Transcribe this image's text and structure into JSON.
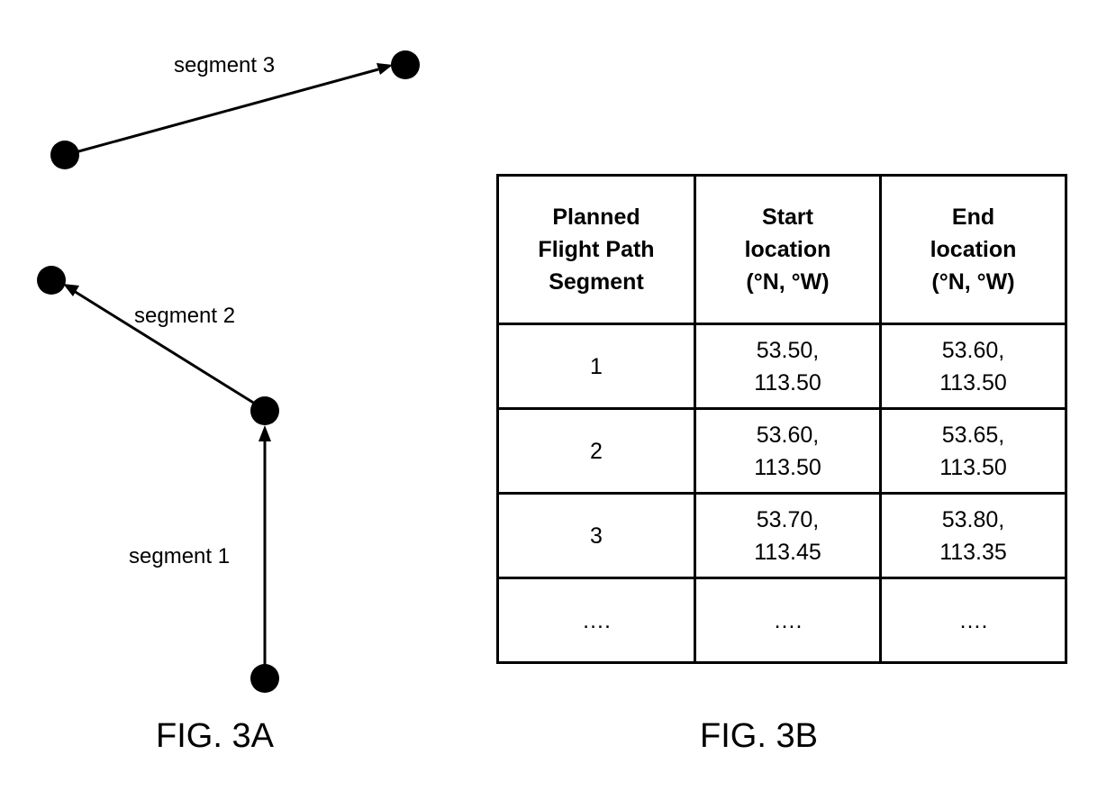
{
  "fig3a": {
    "caption": "FIG. 3A",
    "segments": [
      {
        "label": "segment 1",
        "from": "P0",
        "to": "P1"
      },
      {
        "label": "segment 2",
        "from": "P1",
        "to": "P2"
      },
      {
        "label": "segment 3",
        "from": "P3",
        "to": "P4"
      }
    ]
  },
  "fig3b": {
    "caption": "FIG. 3B",
    "headers": [
      [
        "Planned",
        "Flight Path",
        "Segment"
      ],
      [
        "Start",
        "location",
        "(°N, °W)"
      ],
      [
        "End",
        "location",
        "(°N, °W)"
      ]
    ],
    "rows": [
      {
        "segment": "1",
        "start": [
          "53.50,",
          "113.50"
        ],
        "end": [
          "53.60,",
          "113.50"
        ]
      },
      {
        "segment": "2",
        "start": [
          "53.60,",
          "113.50"
        ],
        "end": [
          "53.65,",
          "113.50"
        ]
      },
      {
        "segment": "3",
        "start": [
          "53.70,",
          "113.45"
        ],
        "end": [
          "53.80,",
          "113.35"
        ]
      },
      {
        "segment": "….",
        "start": [
          "…."
        ],
        "end": [
          "…."
        ]
      }
    ]
  }
}
